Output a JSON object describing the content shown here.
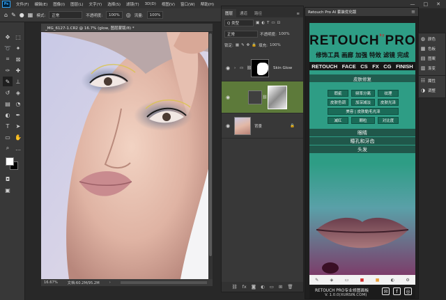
{
  "menubar": {
    "logo": "Ps",
    "items": [
      "文件(F)",
      "编辑(E)",
      "图像(I)",
      "图层(L)",
      "文字(Y)",
      "选择(S)",
      "滤镜(T)",
      "3D(D)",
      "视图(V)",
      "窗口(W)",
      "帮助(H)"
    ],
    "window_controls": [
      "—",
      "□",
      "✕"
    ]
  },
  "optionsbar": {
    "mode_label": "模式:",
    "mode_value": "正常",
    "opacity_label": "不透明度:",
    "opacity_value": "100%",
    "flow_label": "流量:",
    "flow_value": "100%"
  },
  "document": {
    "tab_title": "_MG_6127-1.CR2 @ 16.7% (glow, 图层蒙版/8) *",
    "zoom": "16.67%",
    "doc_info": "文档:60.2M/95.2M"
  },
  "layers_panel": {
    "tabs": [
      "图层",
      "通道",
      "路径"
    ],
    "kind_label": "Q 类型",
    "blend_mode": "正常",
    "opacity_label": "不透明度:",
    "opacity_value": "100%",
    "lock_label": "锁定:",
    "fill_label": "填充:",
    "fill_value": "100%",
    "layers": [
      {
        "name": "Skin Glow",
        "type": "group"
      },
      {
        "name": "",
        "type": "masked"
      },
      {
        "name": "背景",
        "type": "background"
      }
    ],
    "footer_icons": [
      "link-icon",
      "fx-icon",
      "mask-icon",
      "adjustment-icon",
      "group-icon",
      "new-layer-icon",
      "delete-icon"
    ],
    "footer_glyphs": [
      "⛓",
      "fx",
      "◙",
      "◐",
      "▭",
      "⊞",
      "🗑"
    ]
  },
  "retouch_panel": {
    "title": "Retouch Pro AI 套装优化版",
    "logo_left": "RETOUCH",
    "logo_by": "by",
    "logo_right": "PRO",
    "cn_tools": "修饰工具 画廊 加强 特效 滤镜 完成",
    "en_tools": [
      "RETOUCH",
      "FACE",
      "CS",
      "FX",
      "CG",
      "FINISH"
    ],
    "section_skin": "皮肤修复",
    "skin_buttons": [
      "瑕疵",
      "频率分离",
      "纹理",
      "皮肤色调",
      "加深减淡",
      "皮肤光泽"
    ],
    "skin_wide_button": "美容 | 皮肤黏毛光泽",
    "skin_small_buttons": [
      "减红",
      "颗粒",
      "对比度"
    ],
    "bar_eyes": "眼睛",
    "bar_teeth": "瞳孔和牙齿",
    "bar_hair": "头发",
    "footer_line1": "RETOUCH PRO专业修图面板",
    "footer_line2": "V. 1.0.0(XURSIN.COM)",
    "social": [
      "✉",
      "f",
      "◎"
    ]
  },
  "mini_panel": {
    "items": [
      "颜色",
      "色板",
      "图案",
      "渐变",
      "属性",
      "调整"
    ]
  },
  "colors": {
    "accent_green": "#2e9d85",
    "selected_layer": "#5d7a3a",
    "ps_blue": "#31a8ff"
  }
}
